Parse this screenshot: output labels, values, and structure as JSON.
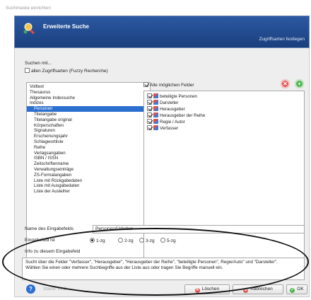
{
  "window_title": "Suchmaske einrichten",
  "header": {
    "title": "Erweiterte Suche",
    "link": "Zugriffsarten festlegen"
  },
  "search": {
    "section_label": "Suchen mit...",
    "fuzzy_label": "allen Zugriffsarten (Fuzzy Recherche)",
    "items": [
      {
        "label": "Volltext",
        "indent": 0,
        "selected": false
      },
      {
        "label": "Thesaurus",
        "indent": 0,
        "selected": false
      },
      {
        "label": "Allgemeine Indexsuche",
        "indent": 0,
        "selected": false
      },
      {
        "label": "Indizes",
        "indent": 0,
        "selected": false
      },
      {
        "label": "Personen",
        "indent": 1,
        "selected": true
      },
      {
        "label": "Titelangabe",
        "indent": 1,
        "selected": false
      },
      {
        "label": "Titelangabe original",
        "indent": 1,
        "selected": false
      },
      {
        "label": "Körperschaften",
        "indent": 1,
        "selected": false
      },
      {
        "label": "Signaturen",
        "indent": 1,
        "selected": false
      },
      {
        "label": "Erscheinungsjahr",
        "indent": 1,
        "selected": false
      },
      {
        "label": "Schlagwortliste",
        "indent": 1,
        "selected": false
      },
      {
        "label": "Reihe",
        "indent": 1,
        "selected": false
      },
      {
        "label": "Verlagsangaben",
        "indent": 1,
        "selected": false
      },
      {
        "label": "ISBN / ISSN",
        "indent": 1,
        "selected": false
      },
      {
        "label": "Zeitschriftenname",
        "indent": 1,
        "selected": false
      },
      {
        "label": "Verwaltungseinträge",
        "indent": 1,
        "selected": false
      },
      {
        "label": "ZS-Formalangaben",
        "indent": 1,
        "selected": false
      },
      {
        "label": "Liste mit Rückgabedaten",
        "indent": 1,
        "selected": false
      },
      {
        "label": "Liste mit Ausgabedaten",
        "indent": 1,
        "selected": false
      },
      {
        "label": "Liste der Ausleiher",
        "indent": 1,
        "selected": false
      }
    ]
  },
  "fields": {
    "all_label": "Alle möglichen Felder",
    "items": [
      "beteiligte Personen",
      "Darsteller",
      "Herausgeber",
      "Herausgeber der Reihe",
      "Regie / Autor",
      "Verfasser"
    ]
  },
  "input_field": {
    "name_label": "Name des Eingabefelds",
    "name_value": "Personen/Urheber",
    "type_label": "Eingabefeld ist",
    "options": [
      "1-zg",
      "2-zg",
      "3-zg",
      "5-zg"
    ],
    "selected_option": "1-zg",
    "info_label": "Info zu diesem Eingabefeld",
    "info_text": "Sucht über die Felder \"Verfasser\", \"Herausgeber\", \"Herausgeber der Reihe\", \"beteiligte Personen\", Regie/Auto\" und \"Darsteller\".\nWählen Sie einen oder mehrere Suchbegriffe aus der Liste aus oder tragen Sie Begriffe manuell ein."
  },
  "footer": {
    "version": "Stand: v1.2",
    "delete_label": "Löschen",
    "cancel_label": "Abbrechen",
    "ok_label": "OK"
  },
  "colors": {
    "banner": "#1f4a8f",
    "selection": "#2b6fcf",
    "annotation": "#111111"
  }
}
